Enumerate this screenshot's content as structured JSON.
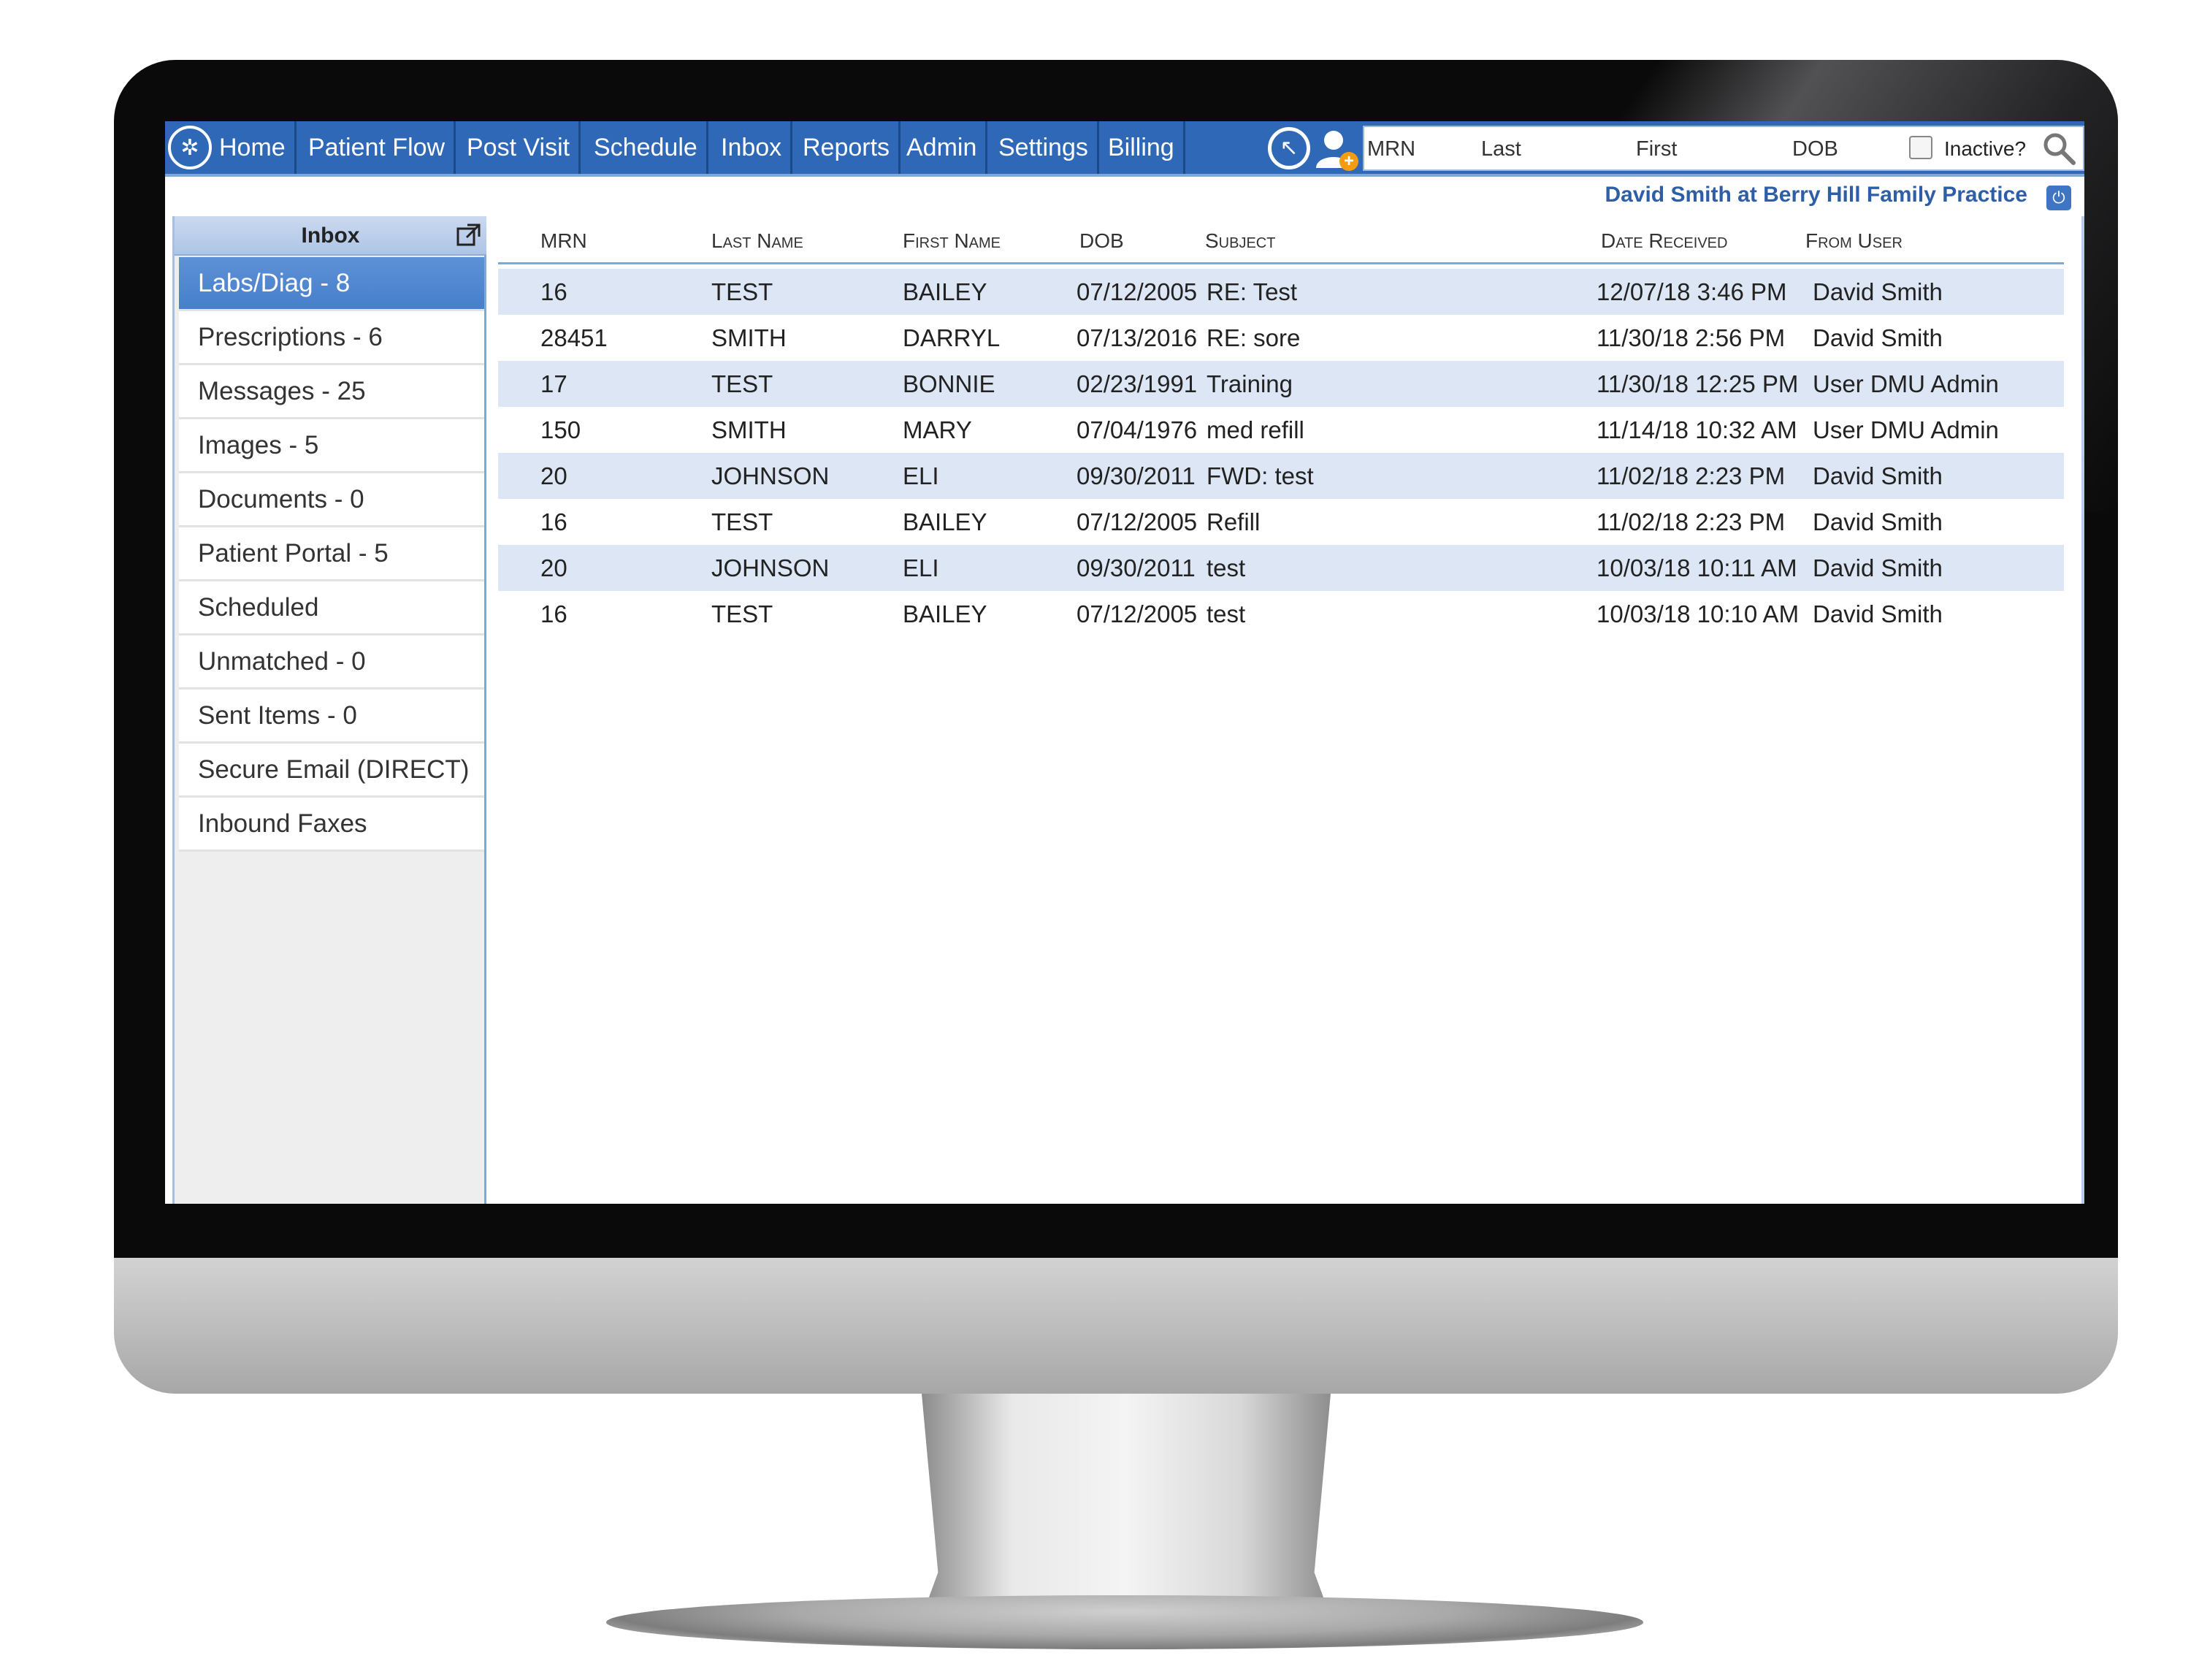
{
  "nav": {
    "items": [
      "Home",
      "Patient Flow",
      "Post Visit",
      "Schedule",
      "Inbox",
      "Reports",
      "Admin",
      "Settings",
      "Billing"
    ]
  },
  "search": {
    "mrn_placeholder": "MRN",
    "last_placeholder": "Last",
    "first_placeholder": "First",
    "dob_placeholder": "DOB",
    "inactive_label": "Inactive?"
  },
  "header": {
    "user_practice": "David Smith at Berry Hill Family Practice"
  },
  "sidebar": {
    "title": "Inbox",
    "items": [
      {
        "label": "Labs/Diag - 8",
        "active": true
      },
      {
        "label": "Prescriptions - 6"
      },
      {
        "label": "Messages - 25"
      },
      {
        "label": "Images - 5"
      },
      {
        "label": "Documents - 0"
      },
      {
        "label": "Patient Portal - 5"
      },
      {
        "label": "Scheduled"
      },
      {
        "label": "Unmatched - 0"
      },
      {
        "label": "Sent Items - 0"
      },
      {
        "label": "Secure Email (DIRECT)"
      },
      {
        "label": "Inbound Faxes"
      }
    ]
  },
  "table": {
    "columns": [
      "MRN",
      "Last Name",
      "First Name",
      "DOB",
      "Subject",
      "Date Received",
      "From User"
    ],
    "rows": [
      [
        "16",
        "TEST",
        "BAILEY",
        "07/12/2005",
        "RE: Test",
        "12/07/18 3:46 PM",
        "David Smith"
      ],
      [
        "28451",
        "SMITH",
        "DARRYL",
        "07/13/2016",
        "RE: sore",
        "11/30/18 2:56 PM",
        "David Smith"
      ],
      [
        "17",
        "TEST",
        "BONNIE",
        "02/23/1991",
        "Training",
        "11/30/18 12:25 PM",
        "User DMU Admin"
      ],
      [
        "150",
        "SMITH",
        "MARY",
        "07/04/1976",
        "med refill",
        "11/14/18 10:32 AM",
        "User DMU Admin"
      ],
      [
        "20",
        "JOHNSON",
        "ELI",
        "09/30/2011",
        "FWD: test",
        "11/02/18 2:23 PM",
        "David Smith"
      ],
      [
        "16",
        "TEST",
        "BAILEY",
        "07/12/2005",
        "Refill",
        "11/02/18 2:23 PM",
        "David Smith"
      ],
      [
        "20",
        "JOHNSON",
        "ELI",
        "09/30/2011",
        "test",
        "10/03/18 10:11 AM",
        "David Smith"
      ],
      [
        "16",
        "TEST",
        "BAILEY",
        "07/12/2005",
        "test",
        "10/03/18 10:10 AM",
        "David Smith"
      ]
    ]
  },
  "colors": {
    "nav_bg": "#2e68b6",
    "active_item": "#4f86cf",
    "row_alt": "#dce6f4",
    "user_text": "#2e5fa6"
  }
}
